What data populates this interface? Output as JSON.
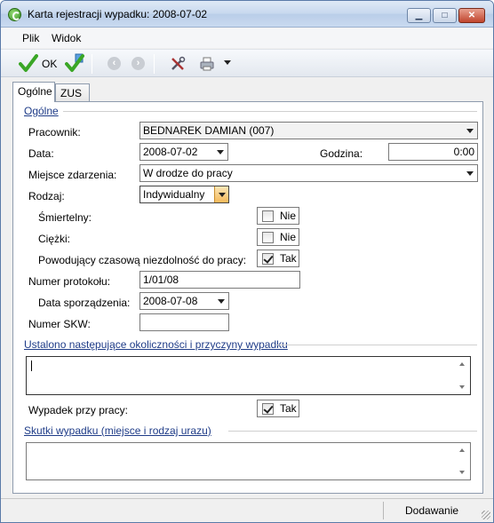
{
  "window": {
    "title": "Karta rejestracji wypadku: 2008-07-02"
  },
  "menu": {
    "items": [
      "Plik",
      "Widok"
    ]
  },
  "toolbar": {
    "ok_label": "OK"
  },
  "tabs": [
    {
      "label": "Ogólne"
    },
    {
      "label": "ZUS"
    }
  ],
  "general": {
    "group_title": "Ogólne",
    "pracownik": {
      "label": "Pracownik:",
      "value": "BEDNAREK DAMIAN (007)"
    },
    "data": {
      "label": "Data:",
      "value": "2008-07-02"
    },
    "godzina": {
      "label": "Godzina:",
      "value": "0:00"
    },
    "miejsce": {
      "label": "Miejsce zdarzenia:",
      "value": "W drodze do pracy"
    },
    "rodzaj": {
      "label": "Rodzaj:",
      "value": "Indywidualny"
    },
    "smiertelny": {
      "label": "Śmiertelny:",
      "value": "Nie",
      "checked": false
    },
    "ciezki": {
      "label": "Ciężki:",
      "value": "Nie",
      "checked": false
    },
    "niezdolnosc": {
      "label": "Powodujący czasową niezdolność do pracy:",
      "value": "Tak",
      "checked": true
    },
    "numer_protokolu": {
      "label": "Numer protokołu:",
      "value": "1/01/08"
    },
    "data_sporzadzenia": {
      "label": "Data sporządzenia:",
      "value": "2008-07-08"
    },
    "numer_skw": {
      "label": "Numer SKW:",
      "value": ""
    }
  },
  "okolicznosci": {
    "group_title": "Ustalono następujące okoliczności i przyczyny wypadku",
    "value": ""
  },
  "wypadek_przy_pracy": {
    "label": "Wypadek przy pracy:",
    "value": "Tak",
    "checked": true
  },
  "skutki": {
    "group_title": "Skutki wypadku (miejsce i rodzaj urazu)",
    "value": ""
  },
  "status": {
    "mode": "Dodawanie"
  },
  "colors": {
    "accent": "#1f3c88",
    "ok_green": "#3aa626"
  }
}
